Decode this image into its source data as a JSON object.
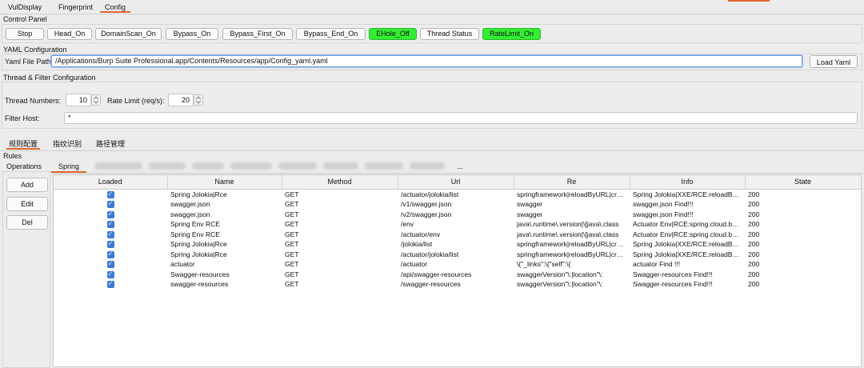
{
  "top_tabs": [
    "VulDisplay",
    "Fingerprint",
    "Config"
  ],
  "control_panel": {
    "title": "Control Panel",
    "buttons": [
      {
        "label": "Stop",
        "on": false
      },
      {
        "label": "Head_On",
        "on": false
      },
      {
        "label": "DomainScan_On",
        "on": false
      },
      {
        "label": "Bypass_On",
        "on": false
      },
      {
        "label": "Bypass_First_On",
        "on": false
      },
      {
        "label": "Bypass_End_On",
        "on": false
      },
      {
        "label": "EHole_Off",
        "on": true
      },
      {
        "label": "Thread Status",
        "on": false
      },
      {
        "label": "RateLimit_On",
        "on": true
      }
    ]
  },
  "yaml": {
    "title": "YAML Configuration",
    "path_label": "Yaml File Path:",
    "path_value": "/Applications/Burp Suite Professional.app/Contents/Resources/app/Config_yaml.yaml",
    "load_button": "Load Yaml"
  },
  "thread": {
    "title": "Thread & Filter Configuration",
    "thread_label": "Thread Numbers:",
    "thread_value": "10",
    "rate_label": "Rate Limit (req/s):",
    "rate_value": "20",
    "filter_label": "Filter Host:",
    "filter_value": "*"
  },
  "sub_tabs": [
    "规则配置",
    "指纹识别",
    "路径管理"
  ],
  "rules": {
    "title": "Rules",
    "operations_label": "Operations",
    "buttons": [
      "Add",
      "Edit",
      "Del"
    ],
    "active_tab": "Spring",
    "overflow": "..."
  },
  "table": {
    "columns": [
      "Loaded",
      "Name",
      "Method",
      "Url",
      "Re",
      "Info",
      "State"
    ],
    "rows": [
      {
        "loaded": true,
        "name": "Spring Jolokia|Rce",
        "method": "GET",
        "url": "/actuator/jolokia/list",
        "re": "springframework|reloadByURL|createJNDIRealm",
        "info": "Spring Jolokia|XXE/RCE:reloadByURL",
        "state": "200"
      },
      {
        "loaded": true,
        "name": "swagger.json",
        "method": "GET",
        "url": "/v1/swagger.json",
        "re": "swagger",
        "info": "swagger.json Find!!!",
        "state": "200"
      },
      {
        "loaded": true,
        "name": "swagger.json",
        "method": "GET",
        "url": "/v2/swagger.json",
        "re": "swagger",
        "info": "swagger.json Find!!!",
        "state": "200"
      },
      {
        "loaded": true,
        "name": "Spring Env RCE",
        "method": "GET",
        "url": "/env",
        "re": "java\\.runtime\\.version|\\[java\\.class",
        "info": "Actuator Env|RCE:spring.cloud.bootstrap",
        "state": "200"
      },
      {
        "loaded": true,
        "name": "Spring Env RCE",
        "method": "GET",
        "url": "/actuator/env",
        "re": "java\\.runtime\\.version|\\[java\\.class",
        "info": "Actuator Env|RCE:spring.cloud.bootstrap",
        "state": "200"
      },
      {
        "loaded": true,
        "name": "Spring Jolokia|Rce",
        "method": "GET",
        "url": "/jolokia/list",
        "re": "springframework|reloadByURL|createJNDIRealm",
        "info": "Spring Jolokia|XXE/RCE:reloadByURL",
        "state": "200"
      },
      {
        "loaded": true,
        "name": "Spring Jolokia|Rce",
        "method": "GET",
        "url": "/actuator/jolokia/list",
        "re": "springframework|reloadByURL|createJNDIRealm",
        "info": "Spring Jolokia|XXE/RCE:reloadByURL",
        "state": "200"
      },
      {
        "loaded": true,
        "name": "actuator",
        "method": "GET",
        "url": "/actuator",
        "re": "\\{\"_links\":\\{\"self\":\\{",
        "info": "actuator Find !!!",
        "state": "200"
      },
      {
        "loaded": true,
        "name": "Swagger-resources",
        "method": "GET",
        "url": "/api/swagger-resources",
        "re": "swaggerVersion\"\\:|location\"\\:",
        "info": "Swagger-resources Find!!!",
        "state": "200"
      },
      {
        "loaded": true,
        "name": "swagger-resources",
        "method": "GET",
        "url": "/swagger-resources",
        "re": "swaggerVersion\"\\:|location\"\\:",
        "info": "Swagger-resources Find!!!",
        "state": "200"
      }
    ]
  }
}
